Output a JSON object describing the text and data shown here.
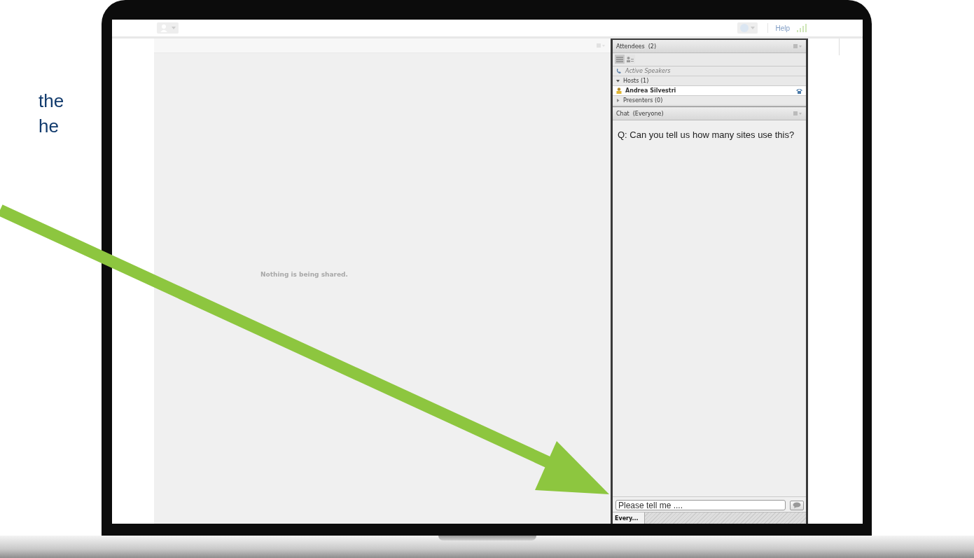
{
  "caption_lines": [
    "the",
    "he"
  ],
  "toolbar": {
    "help_link": "Help"
  },
  "share_pod": {
    "message": "Nothing is being shared."
  },
  "attendees": {
    "title": "Attendees",
    "count": "(2)",
    "view_toggle": [
      {
        "selected": true
      },
      {
        "selected": false
      }
    ],
    "active_speakers": "Active Speakers",
    "groups": [
      {
        "label": "Hosts (1)",
        "expanded": true,
        "children": [
          {
            "name": "Andrea Silvestri"
          }
        ]
      },
      {
        "label": "Presenters (0)",
        "expanded": false
      }
    ]
  },
  "chat": {
    "title": "Chat",
    "audience": "(Everyone)",
    "messages": [
      "Q: Can you tell us how many sites use this?"
    ],
    "input": {
      "value": "Please tell me ...."
    },
    "tabs": [
      {
        "label": "Every...",
        "selected": true
      }
    ]
  }
}
